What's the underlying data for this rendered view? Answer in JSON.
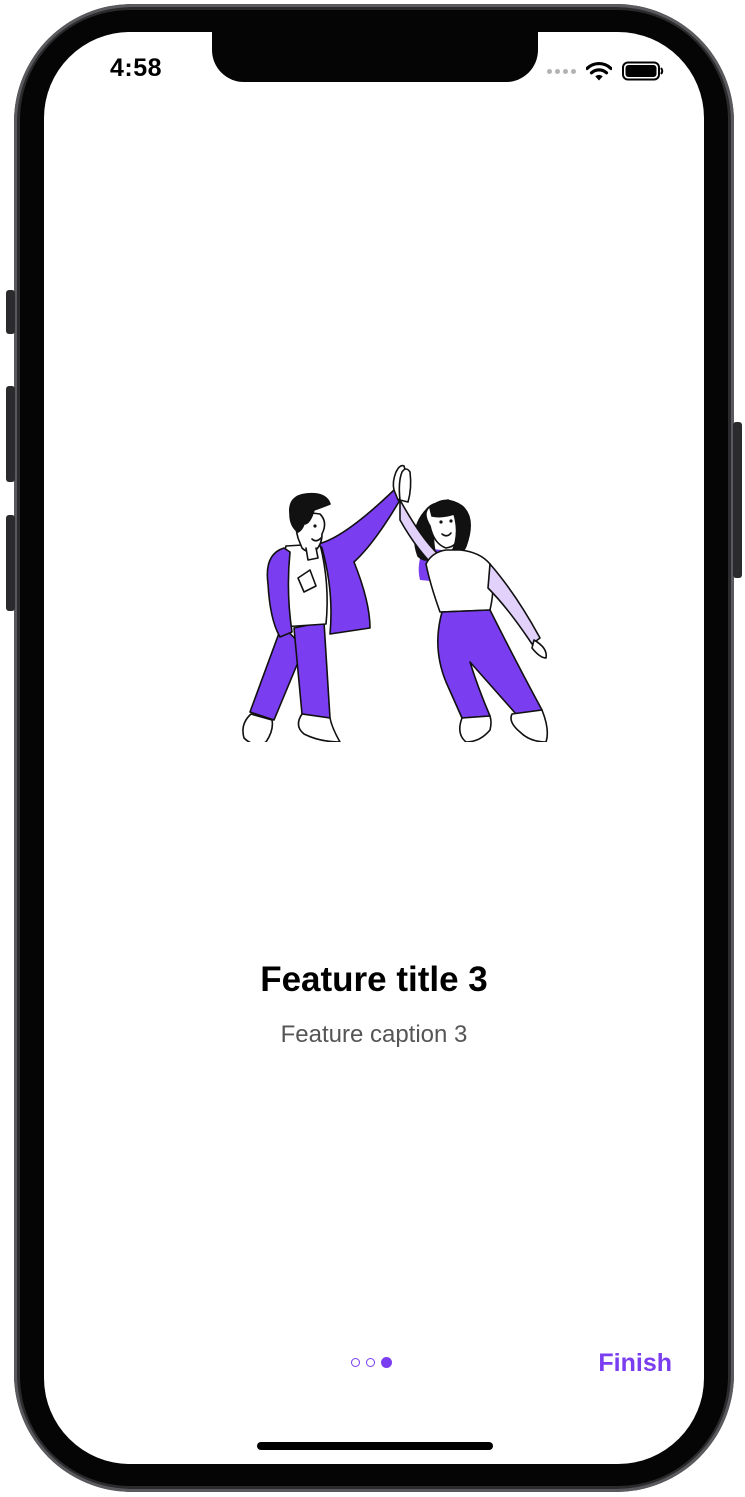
{
  "status_bar": {
    "time": "4:58",
    "signal_icon": "cellular-signal-icon",
    "wifi_icon": "wifi-icon",
    "battery_icon": "battery-icon"
  },
  "onboarding": {
    "illustration": "high-five-illustration",
    "title": "Feature title 3",
    "caption": "Feature caption 3",
    "page_indicator": {
      "total_pages": 3,
      "current_page": 3
    },
    "finish_label": "Finish"
  },
  "colors": {
    "accent": "#7a3df0",
    "accent_light": "#e2d2fb",
    "caption": "#555555"
  }
}
